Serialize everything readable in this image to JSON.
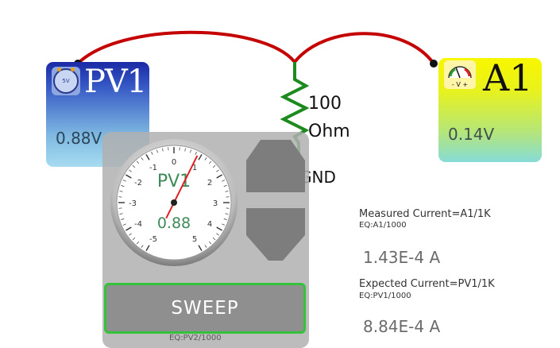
{
  "pv1": {
    "title": "PV1",
    "icon_text": "5V",
    "value": "0.88V"
  },
  "a1": {
    "title": "A1",
    "icon_text": "- V +",
    "value": "0.14V"
  },
  "resistor": {
    "label_line1": "100",
    "label_line2": "Ohm"
  },
  "ground": {
    "label": "GND"
  },
  "gauge": {
    "title": "PV1",
    "value": "0.88",
    "reading": 0.88,
    "scale_min": -5,
    "scale_max": 5,
    "tick_labels": [
      "-5",
      "-4",
      "-3",
      "-2",
      "-1",
      "0",
      "1",
      "2",
      "3",
      "4",
      "5"
    ]
  },
  "controls": {
    "sweep_label": "SWEEP",
    "equation": "EQ:PV2/1000"
  },
  "measured": {
    "label": "Measured Current=A1/1K",
    "equation": "EQ:A1/1000",
    "value": "1.43E-4 A"
  },
  "expected": {
    "label": "Expected Current=PV1/1K",
    "equation": "EQ:PV1/1000",
    "value": "8.84E-4 A"
  },
  "colors": {
    "wire_red": "#c40000",
    "wire_green": "#1c8a1c",
    "sweep_border": "#33c23a",
    "needle": "#e02020",
    "gauge_text": "#3f8a5a"
  }
}
